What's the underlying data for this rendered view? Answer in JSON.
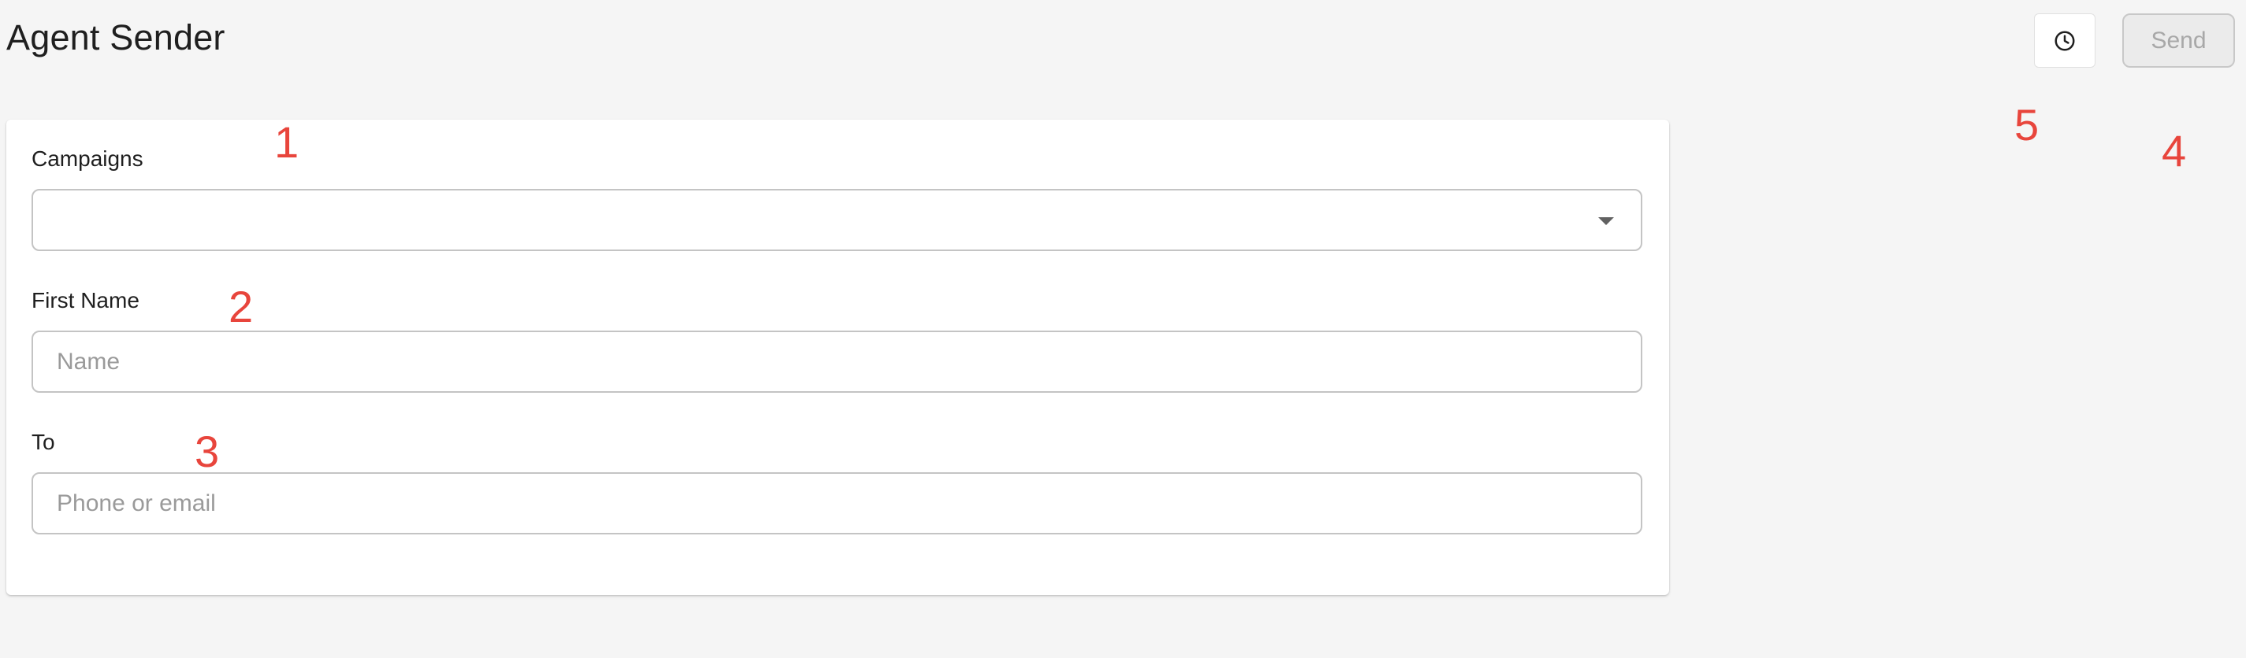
{
  "header": {
    "title": "Agent Sender",
    "history_icon": "clock-icon",
    "send_label": "Send"
  },
  "form": {
    "campaigns": {
      "label": "Campaigns",
      "value": "",
      "icon": "arrow-drop-down-icon"
    },
    "first_name": {
      "label": "First Name",
      "placeholder": "Name",
      "value": ""
    },
    "to": {
      "label": "To",
      "placeholder": "Phone or email",
      "value": ""
    }
  },
  "annotations": {
    "campaigns": "1",
    "first_name": "2",
    "to": "3",
    "send": "4",
    "history": "5"
  },
  "colors": {
    "background": "#f5f5f5",
    "card": "#ffffff",
    "annotation": "#e8453c",
    "send_disabled_text": "#a8a8a8",
    "field_border": "#c4c4c4"
  }
}
